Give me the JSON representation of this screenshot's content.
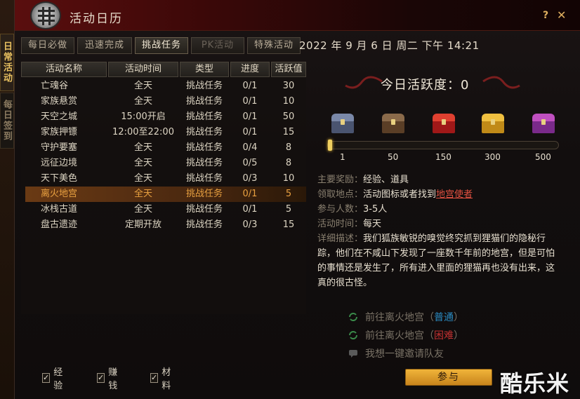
{
  "window": {
    "title": "活动日历",
    "help": "?",
    "close": "✕"
  },
  "side_tabs": [
    "日常活动",
    "每日签到"
  ],
  "tabs": [
    {
      "label": "每日必做",
      "state": "normal"
    },
    {
      "label": "迅速完成",
      "state": "normal"
    },
    {
      "label": "挑战任务",
      "state": "active"
    },
    {
      "label": "PK活动",
      "state": "disabled"
    },
    {
      "label": "特殊活动",
      "state": "normal"
    }
  ],
  "datetime": "2022 年 9 月 6 日 周二 下午 14:21",
  "table": {
    "headers": [
      "活动名称",
      "活动时间",
      "类型",
      "进度",
      "活跃值"
    ],
    "rows": [
      {
        "name": "亡魂谷",
        "time": "全天",
        "type": "挑战任务",
        "progress": "0/1",
        "points": "30"
      },
      {
        "name": "家族悬赏",
        "time": "全天",
        "type": "挑战任务",
        "progress": "0/1",
        "points": "10"
      },
      {
        "name": "天空之城",
        "time": "15:00开启",
        "type": "挑战任务",
        "progress": "0/1",
        "points": "50"
      },
      {
        "name": "家族押镖",
        "time": "12:00至22:00",
        "type": "挑战任务",
        "progress": "0/1",
        "points": "15"
      },
      {
        "name": "守护要塞",
        "time": "全天",
        "type": "挑战任务",
        "progress": "0/4",
        "points": "8"
      },
      {
        "name": "远征边境",
        "time": "全天",
        "type": "挑战任务",
        "progress": "0/5",
        "points": "8"
      },
      {
        "name": "天下美色",
        "time": "全天",
        "type": "挑战任务",
        "progress": "0/3",
        "points": "10"
      },
      {
        "name": "离火地宫",
        "time": "全天",
        "type": "挑战任务",
        "progress": "0/1",
        "points": "5"
      },
      {
        "name": "冰栈古道",
        "time": "全天",
        "type": "挑战任务",
        "progress": "0/1",
        "points": "5"
      },
      {
        "name": "盘古遗迹",
        "time": "定期开放",
        "type": "挑战任务",
        "progress": "0/3",
        "points": "15"
      }
    ],
    "selected_index": 7
  },
  "filters": [
    {
      "label": "经验",
      "checked": true
    },
    {
      "label": "赚钱",
      "checked": true
    },
    {
      "label": "材料",
      "checked": true
    }
  ],
  "activity": {
    "title": "今日活跃度：0",
    "value": 0,
    "max": 500,
    "milestones": [
      "1",
      "50",
      "150",
      "300",
      "500"
    ],
    "chest_colors": [
      {
        "lid": "#7a88a8",
        "body": "#4a5470"
      },
      {
        "lid": "#8a6a4a",
        "body": "#5a3e26"
      },
      {
        "lid": "#e04030",
        "body": "#a01818"
      },
      {
        "lid": "#f0c040",
        "body": "#c08a18"
      },
      {
        "lid": "#c050c0",
        "body": "#7a2a8a"
      }
    ]
  },
  "details": {
    "reward_label": "主要奖励：",
    "reward": "经验、道具",
    "location_label": "领取地点：",
    "location_prefix": "活动图标或者找到",
    "location_link": "地宫使者",
    "players_label": "参与人数：",
    "players": "3-5人",
    "time_label": "活动时间：",
    "time": "每天",
    "desc_label": "详细描述：",
    "desc": "我们狐族敏锐的嗅觉终究抓到狸猫们的隐秘行踪，他们在不咸山下发现了一座数千年前的地宫，但是可怕的事情还是发生了，所有进入里面的狸猫再也没有出来，这真的很古怪。"
  },
  "actions": [
    {
      "prefix": "前往离火地宫（",
      "tag": "普通",
      "suffix": "）"
    },
    {
      "prefix": "前往离火地宫（",
      "tag": "困难",
      "suffix": "）"
    },
    {
      "label": "我想一键邀请队友"
    }
  ],
  "join_label": "参与",
  "watermark": "酷乐米"
}
